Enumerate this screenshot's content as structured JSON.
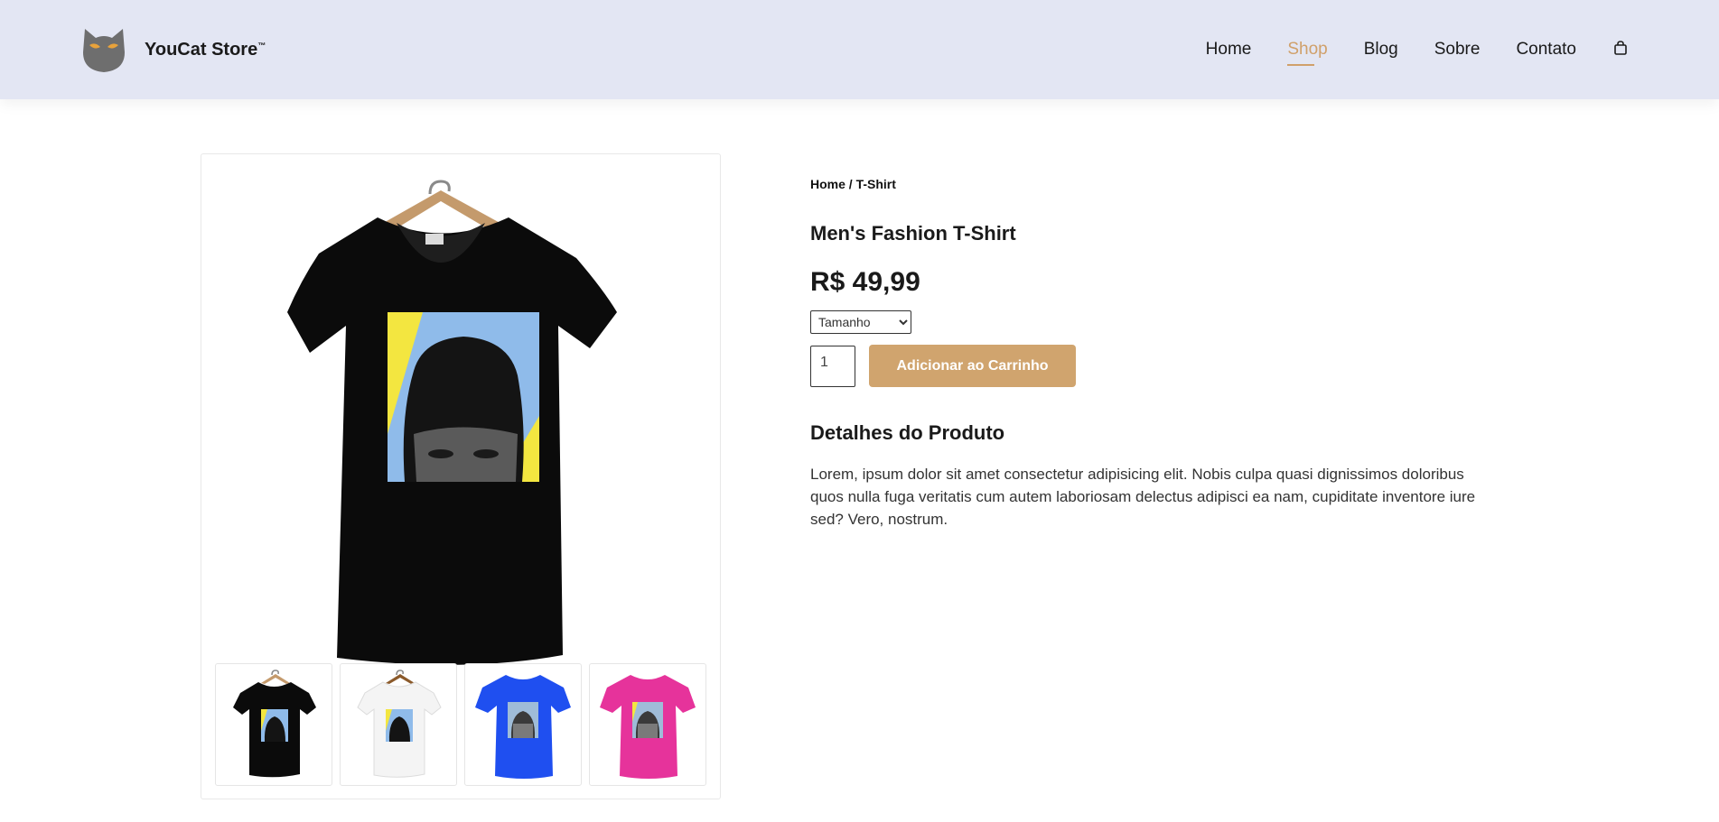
{
  "brand": {
    "name": "YouCat Store",
    "tm": "™",
    "logo_icon": "cat-logo-icon"
  },
  "nav": {
    "items": [
      {
        "label": "Home",
        "active": false
      },
      {
        "label": "Shop",
        "active": true
      },
      {
        "label": "Blog",
        "active": false
      },
      {
        "label": "Sobre",
        "active": false
      },
      {
        "label": "Contato",
        "active": false
      }
    ],
    "cart_icon": "shopping-bag-icon"
  },
  "colors": {
    "accent": "#d0a06a",
    "header_bg": "#e3e6f3",
    "button_bg": "#d0a46e"
  },
  "product": {
    "breadcrumb": "Home / T-Shirt",
    "title": "Men's Fashion T-Shirt",
    "price": "R$ 49,99",
    "size_select": {
      "selected": "Tamanho"
    },
    "quantity": "1",
    "add_to_cart_label": "Adicionar ao Carrinho",
    "details_title": "Detalhes do Produto",
    "description": "Lorem, ipsum dolor sit amet consectetur adipisicing elit. Nobis culpa quasi dignissimos doloribus quos nulla fuga veritatis cum autem laboriosam delectus adipisci ea nam, cupiditate inventore iure sed? Vero, nostrum.",
    "thumbnails": [
      {
        "color": "#0a0a0a"
      },
      {
        "color": "#f4f4f4"
      },
      {
        "color": "#1f4ff0"
      },
      {
        "color": "#e6339b"
      }
    ]
  }
}
